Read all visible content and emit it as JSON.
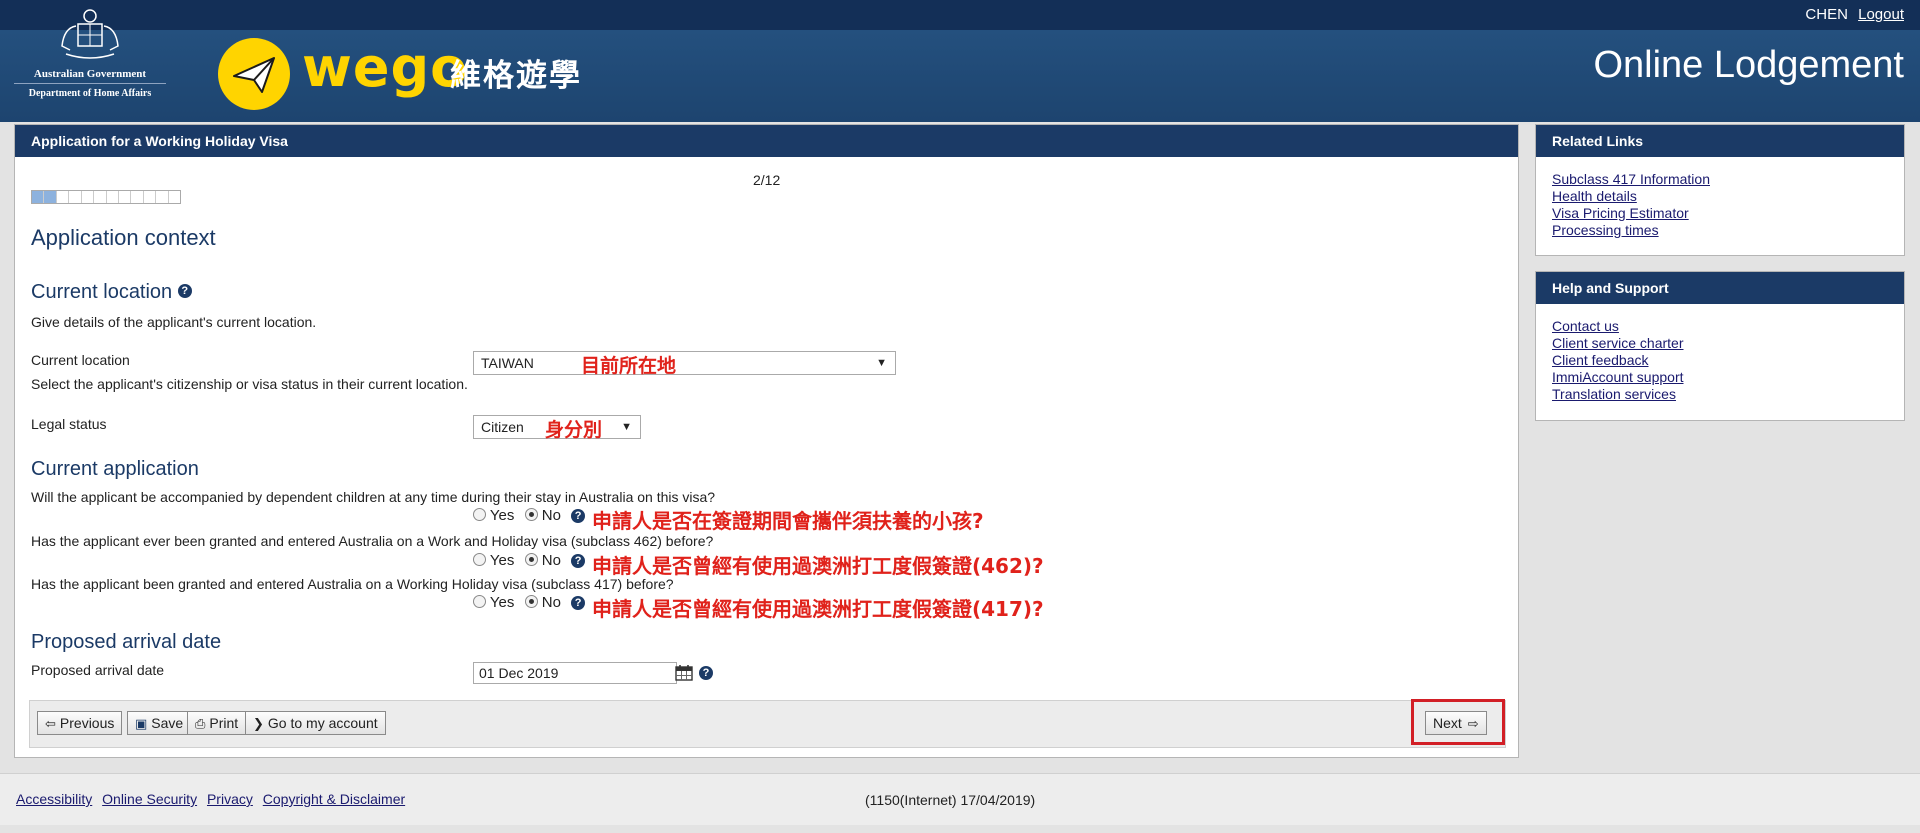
{
  "header": {
    "gov_line1": "Australian Government",
    "gov_line2": "Department of Home Affairs",
    "brand_word": "wego",
    "brand_cn": "維格遊學",
    "user": "CHEN",
    "logout": "Logout",
    "site_title": "Online Lodgement",
    "brand_color": "#ffd400"
  },
  "form": {
    "panel_title": "Application for a Working Holiday Visa",
    "step": "2/12",
    "progress_fraction": 0.167,
    "page_heading": "Application context",
    "current_location": {
      "heading": "Current location",
      "intro": "Give details of the applicant's current location.",
      "location_label": "Current location",
      "location_value": "TAIWAN",
      "location_note": "目前所在地",
      "status_intro": "Select the applicant's citizenship or visa status in their current location.",
      "legal_label": "Legal status",
      "legal_value": "Citizen",
      "legal_note": "身分別"
    },
    "current_application": {
      "heading": "Current application",
      "questions": [
        {
          "text": "Will the applicant be accompanied by dependent children at any time during their stay in Australia on this visa?",
          "yes": "Yes",
          "no": "No",
          "selected": "No",
          "note": "申請人是否在簽證期間會攜伴須扶養的小孩?"
        },
        {
          "text": "Has the applicant ever been granted and entered Australia on a Work and Holiday visa (subclass 462) before?",
          "yes": "Yes",
          "no": "No",
          "selected": "No",
          "note": "申請人是否曾經有使用過澳洲打工度假簽證(462)?"
        },
        {
          "text": "Has the applicant been granted and entered Australia on a Working Holiday visa (subclass 417) before?",
          "yes": "Yes",
          "no": "No",
          "selected": "No",
          "note": "申請人是否曾經有使用過澳洲打工度假簽證(417)?"
        }
      ]
    },
    "arrival": {
      "heading": "Proposed arrival date",
      "label": "Proposed arrival date",
      "value": "01 Dec 2019"
    },
    "buttons": {
      "previous": "Previous",
      "save": "Save",
      "print": "Print",
      "account": "Go to my account",
      "next": "Next"
    }
  },
  "sidebar": {
    "related": {
      "title": "Related Links",
      "links": [
        "Subclass 417 Information",
        "Health details",
        "Visa Pricing Estimator",
        "Processing times"
      ]
    },
    "help": {
      "title": "Help and Support",
      "links": [
        "Contact us",
        "Client service charter",
        "Client feedback",
        "ImmiAccount support",
        "Translation services"
      ]
    }
  },
  "footer": {
    "links": [
      "Accessibility",
      "Online Security",
      "Privacy",
      "Copyright & Disclaimer"
    ],
    "version": "(1150(Internet) 17/04/2019)"
  },
  "icons": {
    "help": "question-circle-icon",
    "calendar": "calendar-icon",
    "previous": "arrow-left-icon",
    "save": "floppy-disk-icon",
    "print": "printer-icon",
    "account": "chevron-right-icon",
    "next": "arrow-right-icon"
  }
}
